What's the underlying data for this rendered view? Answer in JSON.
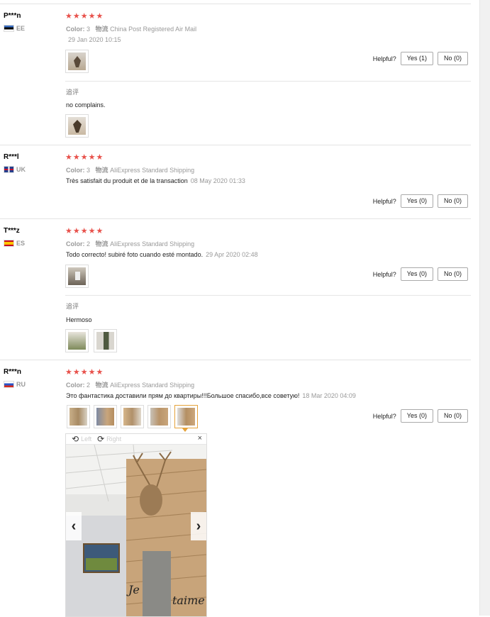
{
  "helpful_label": "Helpful?",
  "additional_label": "追评",
  "reviews": [
    {
      "user": "P***n",
      "country": "EE",
      "stars": "★★★★★",
      "color_label": "Color:",
      "color_value": "3",
      "shipping_label": "物流",
      "shipping": "China Post Registered Air Mail",
      "text": "",
      "date": "29 Jan 2020 10:15",
      "yes": "Yes (1)",
      "no": "No (0)",
      "additional_text": "no complains."
    },
    {
      "user": "R***l",
      "country": "UK",
      "stars": "★★★★★",
      "color_label": "Color:",
      "color_value": "3",
      "shipping_label": "物流",
      "shipping": "AliExpress Standard Shipping",
      "text": "Très satisfait du produit et de la transaction",
      "date": "08 May 2020 01:33",
      "yes": "Yes (0)",
      "no": "No (0)"
    },
    {
      "user": "T***z",
      "country": "ES",
      "stars": "★★★★★",
      "color_label": "Color:",
      "color_value": "2",
      "shipping_label": "物流",
      "shipping": "AliExpress Standard Shipping",
      "text": "Todo correcto! subiré foto cuando esté montado.",
      "date": "29 Apr 2020 02:48",
      "yes": "Yes (0)",
      "no": "No (0)",
      "additional_text": "Hermoso"
    },
    {
      "user": "R***n",
      "country": "RU",
      "stars": "★★★★★",
      "color_label": "Color:",
      "color_value": "2",
      "shipping_label": "物流",
      "shipping": "AliExpress Standard Shipping",
      "text": "Это фантастика доставили прям до квартиры!!!Большое спасибо,все советую!",
      "date": "18 Mar 2020 04:09",
      "yes": "Yes (0)",
      "no": "No (0)"
    }
  ],
  "viewer": {
    "left_label": "Left",
    "right_label": "Right",
    "close": "×",
    "prev": "‹",
    "next": "›"
  },
  "icons": {
    "rotate_left": "⟲",
    "rotate_right": "⟳"
  },
  "colors": {
    "star": "#e8514b",
    "active_thumb": "#e5a23a"
  }
}
